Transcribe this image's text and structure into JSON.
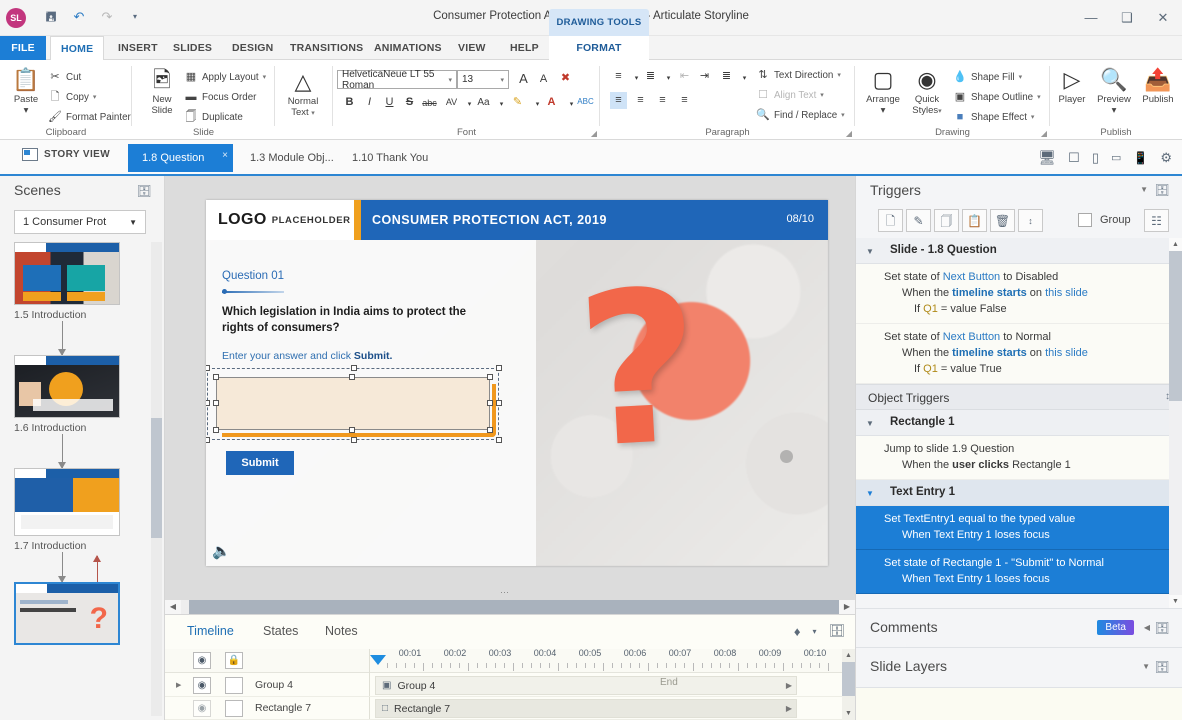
{
  "window": {
    "app_title": "Consumer Protection Act, 2019_v2.story* - Articulate Storyline",
    "contextual_tab_group": "DRAWING TOOLS",
    "orb_label": "SL",
    "quick_access": [
      {
        "name": "save-icon",
        "glyph": "὚B"
      },
      {
        "name": "undo-icon",
        "glyph": "↶"
      },
      {
        "name": "redo-icon",
        "glyph": "↷"
      },
      {
        "name": "customize-qat-icon",
        "glyph": "▾"
      }
    ],
    "controls": [
      {
        "name": "minimize-button",
        "glyph": "—"
      },
      {
        "name": "restore-button",
        "glyph": "❐"
      },
      {
        "name": "close-button",
        "glyph": "✕"
      }
    ],
    "help_label": "?"
  },
  "menu": {
    "tabs": [
      {
        "label": "FILE",
        "id": "file"
      },
      {
        "label": "HOME",
        "id": "home"
      },
      {
        "label": "INSERT",
        "id": "insert"
      },
      {
        "label": "SLIDES",
        "id": "slides"
      },
      {
        "label": "DESIGN",
        "id": "design"
      },
      {
        "label": "TRANSITIONS",
        "id": "transitions"
      },
      {
        "label": "ANIMATIONS",
        "id": "animations"
      },
      {
        "label": "VIEW",
        "id": "view"
      },
      {
        "label": "HELP",
        "id": "help"
      }
    ],
    "format_tab": "FORMAT",
    "active_tab": "HOME"
  },
  "ribbon": {
    "clipboard": {
      "label": "Clipboard",
      "paste": "Paste",
      "cut": "Cut",
      "copy": "Copy",
      "format_painter": "Format Painter"
    },
    "slide": {
      "label": "Slide",
      "new_slide": "New\nSlide",
      "new_slide_l1": "New",
      "new_slide_l2": "Slide",
      "apply_layout": "Apply Layout",
      "focus_order": "Focus Order",
      "duplicate": "Duplicate"
    },
    "text_style": {
      "normal_l1": "Normal",
      "normal_l2": "Text"
    },
    "font": {
      "label": "Font",
      "family": "HelveticaNeue LT 55 Roman",
      "size": "13",
      "buttons": [
        {
          "name": "bold-button",
          "glyph": "B"
        },
        {
          "name": "italic-button",
          "glyph": "I"
        },
        {
          "name": "underline-button",
          "glyph": "U"
        },
        {
          "name": "strikethrough-button",
          "glyph": "S"
        },
        {
          "name": "all-caps-button",
          "glyph": "abc"
        },
        {
          "name": "character-spacing-button",
          "glyph": "AV"
        },
        {
          "name": "change-case-button",
          "glyph": "Aa"
        },
        {
          "name": "text-highlight-button",
          "glyph": "✎"
        },
        {
          "name": "font-color-button",
          "glyph": "A"
        },
        {
          "name": "spelling-button",
          "glyph": "ABC"
        }
      ],
      "grow_font": "A",
      "shrink_font": "A",
      "clear_format": "὘C"
    },
    "paragraph": {
      "label": "Paragraph",
      "text_direction": "Text Direction",
      "align_text": "Align Text",
      "find_replace": "Find / Replace"
    },
    "drawing": {
      "label": "Drawing",
      "arrange": "Arrange",
      "quick_styles_l1": "Quick",
      "quick_styles_l2": "Styles",
      "shape_fill": "Shape Fill",
      "shape_outline": "Shape Outline",
      "shape_effect": "Shape Effect"
    },
    "publish": {
      "label": "Publish",
      "player": "Player",
      "preview": "Preview",
      "publish": "Publish"
    }
  },
  "slide_tabs": {
    "story_view": "STORY VIEW",
    "tabs": [
      {
        "label": "1.8 Question",
        "selected": true
      },
      {
        "label": "1.3 Module Obj...",
        "selected": false
      },
      {
        "label": "1.10 Thank You",
        "selected": false
      }
    ],
    "view_icons": [
      {
        "name": "desktop-preview-icon"
      },
      {
        "name": "browser-preview-icon"
      },
      {
        "name": "tablet-portrait-preview-icon"
      },
      {
        "name": "tablet-landscape-preview-icon"
      },
      {
        "name": "phone-preview-icon"
      },
      {
        "name": "player-settings-gear-icon"
      }
    ]
  },
  "scenes": {
    "title": "Scenes",
    "selected_scene": "1 Consumer Prot",
    "items": [
      {
        "label": "1.5 Introduction",
        "selected": false
      },
      {
        "label": "1.6 Introduction",
        "selected": false
      },
      {
        "label": "1.7 Introduction",
        "selected": false
      },
      {
        "label": "",
        "selected": true
      }
    ]
  },
  "slide": {
    "logo_main": "LOGO",
    "logo_sub": "PLACEHOLDER",
    "header_title": "CONSUMER PROTECTION ACT, 2019",
    "page_indicator": "08/10",
    "question_number": "Question 01",
    "question_text": "Which legislation in India aims to protect the rights of consumers?",
    "hint_prefix": "Enter your answer and click",
    "hint_bold": "Submit.",
    "answer_value": "",
    "answer_placeholder": "",
    "submit_label": "Submit"
  },
  "timeline": {
    "tabs": [
      {
        "label": "Timeline",
        "active": true
      },
      {
        "label": "States",
        "active": false
      },
      {
        "label": "Notes",
        "active": false
      }
    ],
    "header_icons": [
      {
        "name": "eye-visibility-icon",
        "glyph": "◉"
      },
      {
        "name": "lock-icon",
        "glyph": "ὑ2"
      }
    ],
    "ruler_labels": [
      "00:01",
      "00:02",
      "00:03",
      "00:04",
      "00:05",
      "00:06",
      "00:07",
      "00:08",
      "00:09",
      "00:10"
    ],
    "end_label": "End",
    "rows": [
      {
        "name": "Group 4",
        "bar_label": "Group 4",
        "expandable": true
      },
      {
        "name": "Rectangle 7",
        "bar_label": "Rectangle 7",
        "expandable": false
      }
    ],
    "toolbar_icons": [
      {
        "name": "align-timeline-icon"
      },
      {
        "name": "timeline-options-caret-icon"
      },
      {
        "name": "dock-panel-icon"
      }
    ]
  },
  "triggers": {
    "title": "Triggers",
    "toolbar": [
      {
        "name": "new-trigger-button",
        "glyph": "὜B"
      },
      {
        "name": "edit-trigger-button",
        "glyph": "✎"
      },
      {
        "name": "copy-trigger-button",
        "glyph": "Ὕ0"
      },
      {
        "name": "paste-trigger-button",
        "glyph": "ὌB"
      },
      {
        "name": "delete-trigger-button",
        "glyph": "Ὕ1"
      },
      {
        "name": "reorder-trigger-button",
        "glyph": "↕"
      }
    ],
    "group_label": "Group",
    "manage_variables_icon": "⊞",
    "slide_section": "Slide - 1.8 Question",
    "slide_triggers": [
      {
        "action_pre": "Set state of ",
        "action_obj": "Next Button",
        "action_post": " to Disabled",
        "when_pre": "When the ",
        "when_event": "timeline starts",
        "when_post": " on ",
        "when_target": "this slide",
        "cond_pre": "If ",
        "cond_var": "Q1",
        "cond_post": " = value False",
        "selected": false
      },
      {
        "action_pre": "Set state of ",
        "action_obj": "Next Button",
        "action_post": " to Normal",
        "when_pre": "When the ",
        "when_event": "timeline starts",
        "when_post": " on ",
        "when_target": "this slide",
        "cond_pre": "If ",
        "cond_var": "Q1",
        "cond_post": " = value True",
        "selected": false
      }
    ],
    "object_section": "Object Triggers",
    "object_groups": [
      {
        "name": "Rectangle 1",
        "selected": false,
        "items": [
          {
            "action_pre": "Jump to slide ",
            "action_obj": "1.9 Question",
            "action_post": "",
            "when_pre": "When the ",
            "when_event": "user clicks",
            "when_post": " Rectangle 1",
            "when_target": "",
            "selected": false
          }
        ]
      },
      {
        "name": "Text Entry 1",
        "selected": true,
        "items": [
          {
            "action_pre": "Set ",
            "action_obj": "TextEntry1",
            "action_post": " equal to the typed value",
            "when_pre": "When ",
            "when_event": "Text Entry 1",
            "when_post": " loses focus",
            "when_target": "",
            "selected": true
          },
          {
            "action_pre": "Set state of ",
            "action_obj": "Rectangle 1 - \"Submit\"",
            "action_post": " to Normal",
            "when_pre": "When ",
            "when_event": "Text Entry 1",
            "when_post": " loses focus",
            "when_target": "",
            "selected": true
          }
        ]
      }
    ],
    "comments": {
      "title": "Comments",
      "badge": "Beta"
    },
    "slide_layers": {
      "title": "Slide Layers"
    }
  },
  "colors": {
    "accent_blue": "#1c7ed6",
    "ribbon_blue": "#1f66b8",
    "slide_orange": "#f0a01e",
    "question_orange": "#f2674a",
    "entry_fill": "#f6e9d8"
  }
}
